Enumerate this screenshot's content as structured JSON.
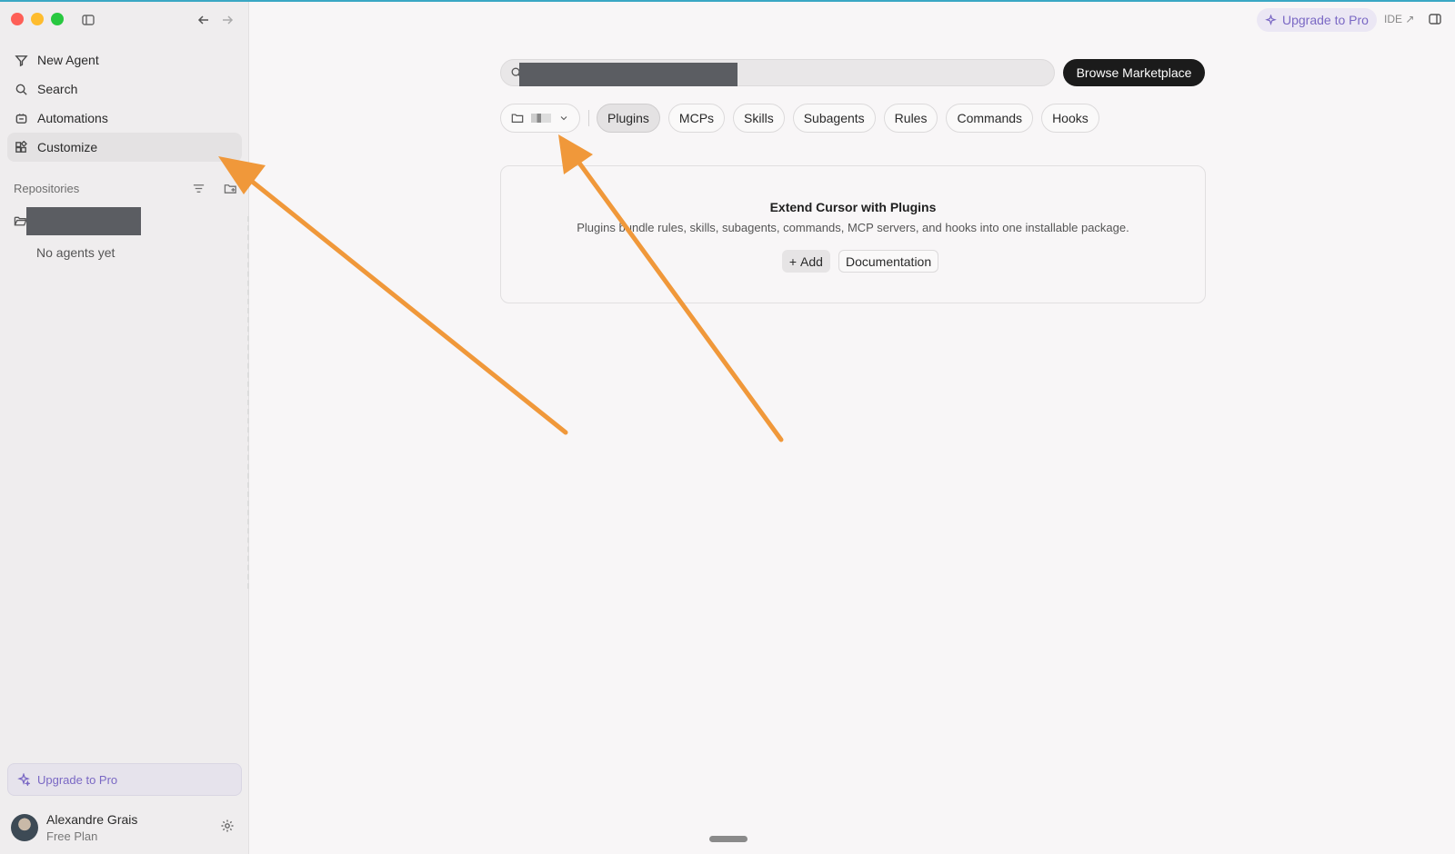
{
  "sidebar": {
    "nav": [
      {
        "label": "New Agent",
        "icon": "agent-icon"
      },
      {
        "label": "Search",
        "icon": "search-icon"
      },
      {
        "label": "Automations",
        "icon": "automations-icon"
      },
      {
        "label": "Customize",
        "icon": "customize-icon",
        "active": true
      }
    ],
    "repositories_label": "Repositories",
    "no_agents": "No agents yet",
    "upgrade_label": "Upgrade to Pro",
    "user": {
      "name": "Alexandre Grais",
      "plan": "Free Plan"
    }
  },
  "topbar": {
    "upgrade_label": "Upgrade to Pro",
    "ide_label": "IDE ↗"
  },
  "main": {
    "search": {
      "value": "",
      "placeholder": ""
    },
    "browse_label": "Browse Marketplace",
    "tabs": [
      {
        "label": "Plugins",
        "active": true
      },
      {
        "label": "MCPs"
      },
      {
        "label": "Skills"
      },
      {
        "label": "Subagents"
      },
      {
        "label": "Rules"
      },
      {
        "label": "Commands"
      },
      {
        "label": "Hooks"
      }
    ],
    "card": {
      "title": "Extend Cursor with Plugins",
      "description": "Plugins bundle rules, skills, subagents, commands, MCP servers, and hooks into one installable package.",
      "add_label": "Add",
      "doc_label": "Documentation"
    }
  },
  "colors": {
    "accent_purple": "#7a68c4",
    "annotation_orange": "#f0983a",
    "dark_button": "#1b1b1b"
  }
}
